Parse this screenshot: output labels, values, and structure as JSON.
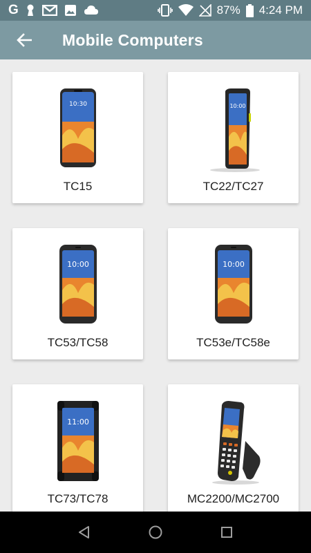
{
  "status_bar": {
    "g_letter": "G",
    "battery_percent": "87%",
    "time": "4:24 PM"
  },
  "app_bar": {
    "title": "Mobile Computers"
  },
  "devices": [
    {
      "label": "TC15",
      "screen_time": "10:30"
    },
    {
      "label": "TC22/TC27",
      "screen_time": "10:00"
    },
    {
      "label": "TC53/TC58",
      "screen_time": "10:00"
    },
    {
      "label": "TC53e/TC58e",
      "screen_time": "10:00"
    },
    {
      "label": "TC73/TC78",
      "screen_time": "11:00"
    },
    {
      "label": "MC2200/MC2700",
      "screen_time": ""
    }
  ],
  "colors": {
    "status_bar": "#5f7c84",
    "app_bar": "#7d9aa2",
    "background": "#ececec"
  },
  "icons": {
    "back": "arrow-left-icon",
    "nav_back": "triangle-back-icon",
    "nav_home": "circle-home-icon",
    "nav_recents": "square-recents-icon"
  }
}
